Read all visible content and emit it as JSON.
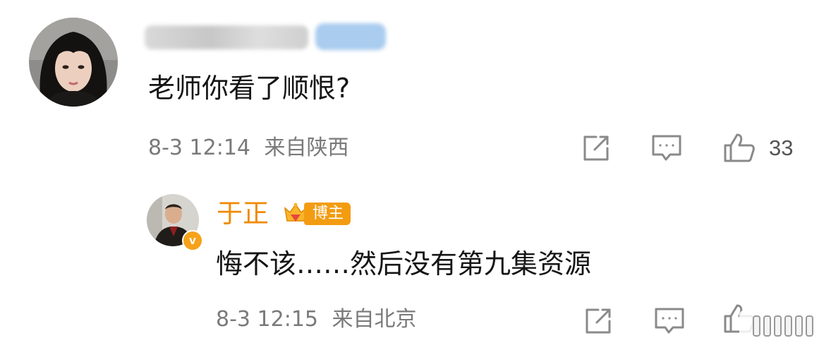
{
  "comment": {
    "text": "老师你看了顺恨?",
    "date": "8-3 12:14",
    "location": "来自陕西",
    "likes": "33",
    "icons": [
      "share-icon",
      "comment-icon",
      "like-icon"
    ]
  },
  "reply": {
    "author": "于正",
    "author_badge": "博主",
    "verified_mark": "v",
    "text": "悔不该……然后没有第九集资源",
    "date": "8-3 12:15",
    "location": "来自北京",
    "icons": [
      "share-icon",
      "comment-icon",
      "like-icon"
    ]
  },
  "colors": {
    "author_name": "#f08a00",
    "badge": "#f39c12",
    "meta_text": "#7a7a7a",
    "icon": "#8a8a8a"
  }
}
